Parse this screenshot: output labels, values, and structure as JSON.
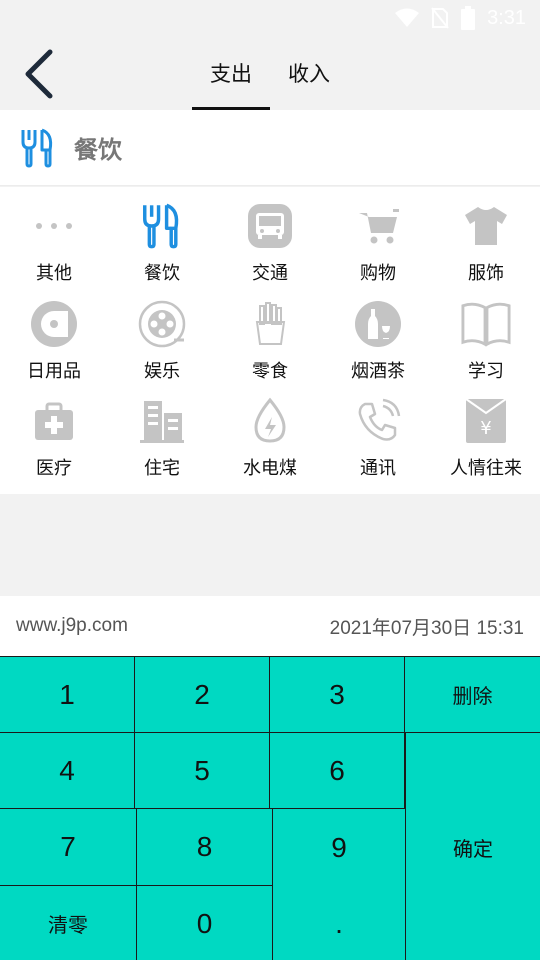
{
  "status": {
    "time": "3:31"
  },
  "header": {
    "tabs": [
      {
        "label": "支出",
        "active": true
      },
      {
        "label": "收入",
        "active": false
      }
    ]
  },
  "selected_category": {
    "label": "餐饮"
  },
  "categories": [
    {
      "label": "其他",
      "icon": "more-dots-icon"
    },
    {
      "label": "餐饮",
      "icon": "fork-knife-icon"
    },
    {
      "label": "交通",
      "icon": "bus-icon"
    },
    {
      "label": "购物",
      "icon": "shopping-cart-icon"
    },
    {
      "label": "服饰",
      "icon": "tshirt-icon"
    },
    {
      "label": "日用品",
      "icon": "tissue-roll-icon"
    },
    {
      "label": "娱乐",
      "icon": "film-reel-icon"
    },
    {
      "label": "零食",
      "icon": "fries-icon"
    },
    {
      "label": "烟酒茶",
      "icon": "wine-bottle-icon"
    },
    {
      "label": "学习",
      "icon": "book-icon"
    },
    {
      "label": "医疗",
      "icon": "medical-kit-icon"
    },
    {
      "label": "住宅",
      "icon": "building-icon"
    },
    {
      "label": "水电煤",
      "icon": "water-drop-icon"
    },
    {
      "label": "通讯",
      "icon": "phone-icon"
    },
    {
      "label": "人情往来",
      "icon": "red-envelope-icon"
    }
  ],
  "info": {
    "watermark": "www.j9p.com",
    "datetime": "2021年07月30日 15:31"
  },
  "keypad": {
    "k1": "1",
    "k2": "2",
    "k3": "3",
    "delete": "删除",
    "k4": "4",
    "k5": "5",
    "k6": "6",
    "k7": "7",
    "k8": "8",
    "k9": "9",
    "confirm": "确定",
    "clear": "清零",
    "k0": "0",
    "dot": "."
  },
  "colors": {
    "accent": "#00d9c2",
    "icon_blue": "#1e8fe0",
    "icon_gray": "#c4c4c4"
  }
}
